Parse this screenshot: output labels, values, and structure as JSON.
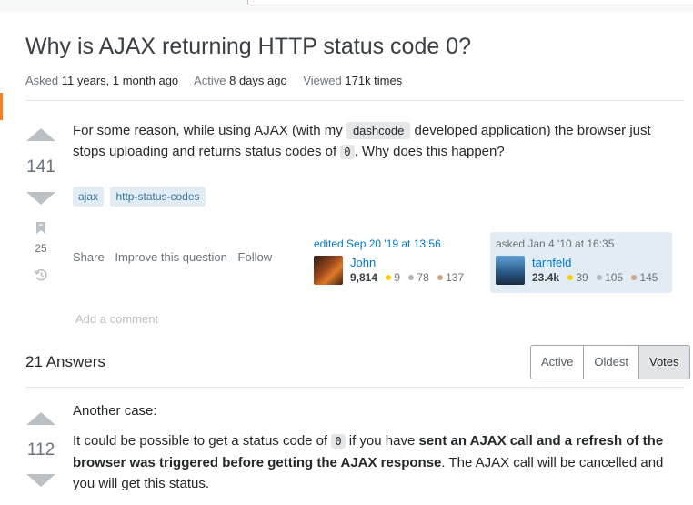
{
  "question": {
    "title": "Why is AJAX returning HTTP status code 0?",
    "meta": {
      "asked_label": "Asked",
      "asked_value": "11 years, 1 month ago",
      "active_label": "Active",
      "active_value": "8 days ago",
      "viewed_label": "Viewed",
      "viewed_value": "171k times"
    },
    "votes": "141",
    "bookmarks": "25",
    "body": {
      "part1": "For some reason, while using AJAX (with my ",
      "dashcode": "dashcode",
      "part2": " developed application) the browser just stops uploading and returns status codes of ",
      "code0": "0",
      "part3": ". Why does this happen?"
    },
    "tags": [
      "ajax",
      "http-status-codes"
    ],
    "menu": {
      "share": "Share",
      "improve": "Improve this question",
      "follow": "Follow"
    },
    "edited": {
      "action": "edited Sep 20 '19 at 13:56",
      "name": "John",
      "rep": "9,814",
      "gold": "9",
      "silver": "78",
      "bronze": "137"
    },
    "asked": {
      "action": "asked Jan 4 '10 at 16:35",
      "name": "tarnfeld",
      "rep": "23.4k",
      "gold": "39",
      "silver": "105",
      "bronze": "145"
    },
    "add_comment": "Add a comment"
  },
  "answers": {
    "header": "21 Answers",
    "sort_options": [
      "Active",
      "Oldest",
      "Votes"
    ],
    "selected_sort": "Votes",
    "first": {
      "votes": "112",
      "p1": "Another case:",
      "p2_a": "It could be possible to get a status code of ",
      "p2_code": "0",
      "p2_b": " if you have ",
      "p2_bold": "sent an AJAX call and a refresh of the browser was triggered before getting the AJAX response",
      "p2_c": ". The AJAX call will be cancelled and you will get this status."
    }
  },
  "colors": {
    "accent_orange": "#f48024",
    "link_blue": "#0077cc",
    "tag_bg": "#e1ecf4",
    "tag_text": "#39739d"
  },
  "icons": [
    "upvote-icon",
    "downvote-icon",
    "bookmark-icon",
    "history-icon",
    "avatar"
  ]
}
